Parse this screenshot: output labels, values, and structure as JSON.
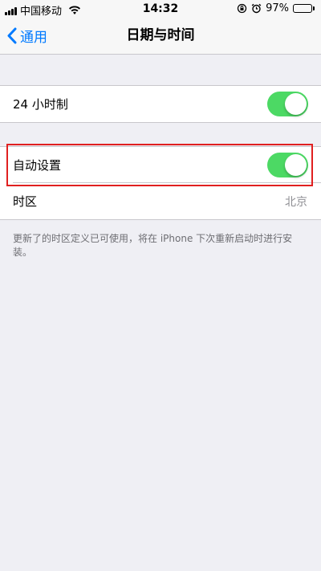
{
  "status_bar": {
    "carrier": "中国移动",
    "time": "14:32",
    "battery_percent": "97%",
    "battery_level": 0.97,
    "icons": [
      "signal-icon",
      "wifi-icon",
      "rotation-lock-icon",
      "alarm-icon",
      "battery-icon"
    ]
  },
  "nav": {
    "back_label": "通用",
    "title": "日期与时间"
  },
  "settings": {
    "hour24": {
      "label": "24 小时制",
      "on": true
    },
    "auto_set": {
      "label": "自动设置",
      "on": true
    },
    "timezone": {
      "label": "时区",
      "value": "北京"
    }
  },
  "footer_note": "更新了的时区定义已可使用，将在 iPhone 下次重新启动时进行安装。",
  "colors": {
    "accent": "#007aff",
    "toggle_on": "#4cd964",
    "highlight": "#e02020",
    "background": "#efeff4"
  }
}
